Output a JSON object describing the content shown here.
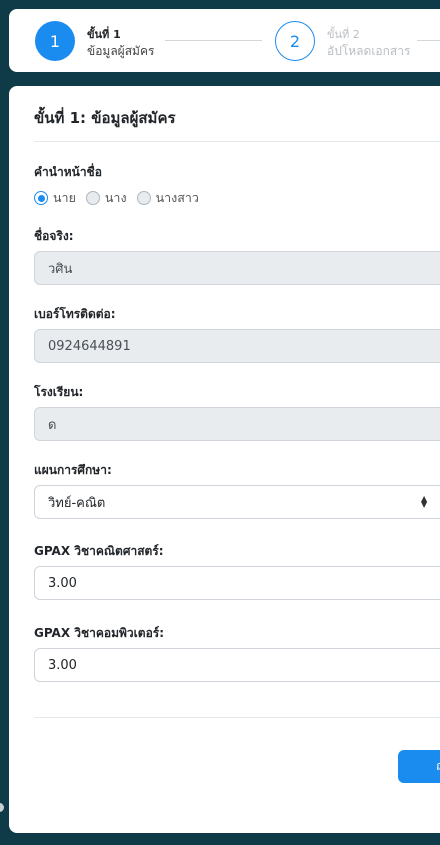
{
  "stepper": {
    "step1": {
      "number": "1",
      "title": "ขั้นที่ 1",
      "subtitle": "ข้อมูลผู้สมัคร"
    },
    "step2": {
      "number": "2",
      "title": "ขั้นที่ 2",
      "subtitle": "อัปโหลดเอกสาร"
    }
  },
  "form": {
    "title": "ขั้นที่ 1: ข้อมูลผู้สมัคร",
    "prefix": {
      "label": "คำนำหน้าชื่อ",
      "options": [
        "นาย",
        "นาง",
        "นางสาว"
      ],
      "selected": "นาย"
    },
    "first_name": {
      "label": "ชื่อจริง:",
      "value": "วศิน"
    },
    "phone": {
      "label": "เบอร์โทรติดต่อ:",
      "value": "0924644891"
    },
    "school": {
      "label": "โรงเรียน:",
      "value": "ด"
    },
    "study_plan": {
      "label": "แผนการศึกษา:",
      "value": "วิทย์-คณิต"
    },
    "gpax_math": {
      "label": "GPAX วิชาคณิตศาสตร์:",
      "value": "3.00"
    },
    "gpax_computer": {
      "label": "GPAX วิชาคอมพิวเตอร์:",
      "value": "3.00"
    },
    "next_button_label": "ถ"
  },
  "colors": {
    "accent": "#1a8cf0",
    "background": "#0f3a47"
  }
}
